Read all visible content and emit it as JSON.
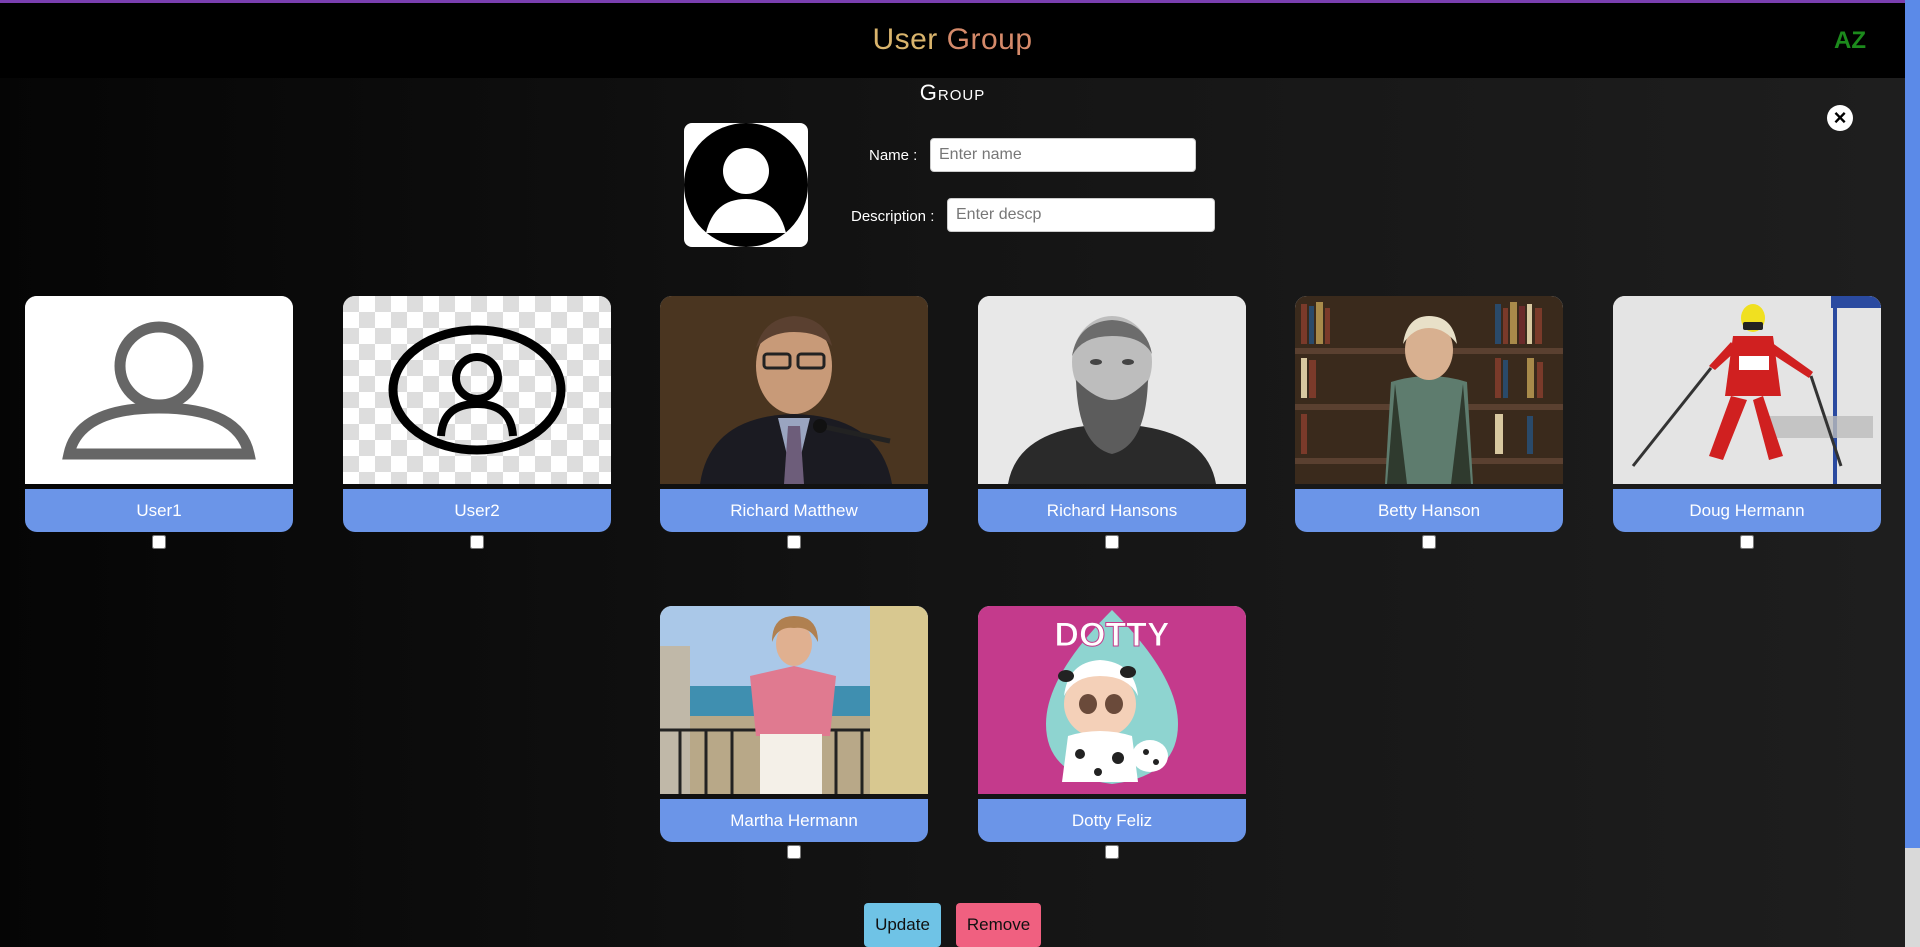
{
  "header": {
    "title_word1": "User",
    "title_word2": "Group",
    "sort_label": "AZ"
  },
  "form": {
    "heading": "Group",
    "close_icon": "×",
    "name_label": "Name :",
    "name_placeholder": "Enter name",
    "description_label": "Description :",
    "description_placeholder": "Enter descp"
  },
  "users": [
    {
      "name": "User1",
      "image": "person-outline-icon",
      "checked": false
    },
    {
      "name": "User2",
      "image": "person-circle-icon",
      "checked": false
    },
    {
      "name": "Richard Matthew",
      "image": "photo-man-speaking",
      "checked": false
    },
    {
      "name": "Richard Hansons",
      "image": "photo-bearded-man",
      "checked": false
    },
    {
      "name": "Betty Hanson",
      "image": "photo-woman-bookshelf",
      "checked": false
    },
    {
      "name": "Doug Hermann",
      "image": "photo-skier",
      "checked": false
    },
    {
      "name": "Martha Hermann",
      "image": "photo-woman-balcony",
      "checked": false
    },
    {
      "name": "Dotty Feliz",
      "image": "dotty-cartoon",
      "checked": false
    }
  ],
  "dotty_text": "DOTTY",
  "actions": {
    "update_label": "Update",
    "remove_label": "Remove"
  },
  "colors": {
    "card_label_bg": "#6b95e8",
    "update_bg": "#6fc3e6",
    "remove_bg": "#f06080",
    "sort_icon": "#1c8a1c"
  }
}
